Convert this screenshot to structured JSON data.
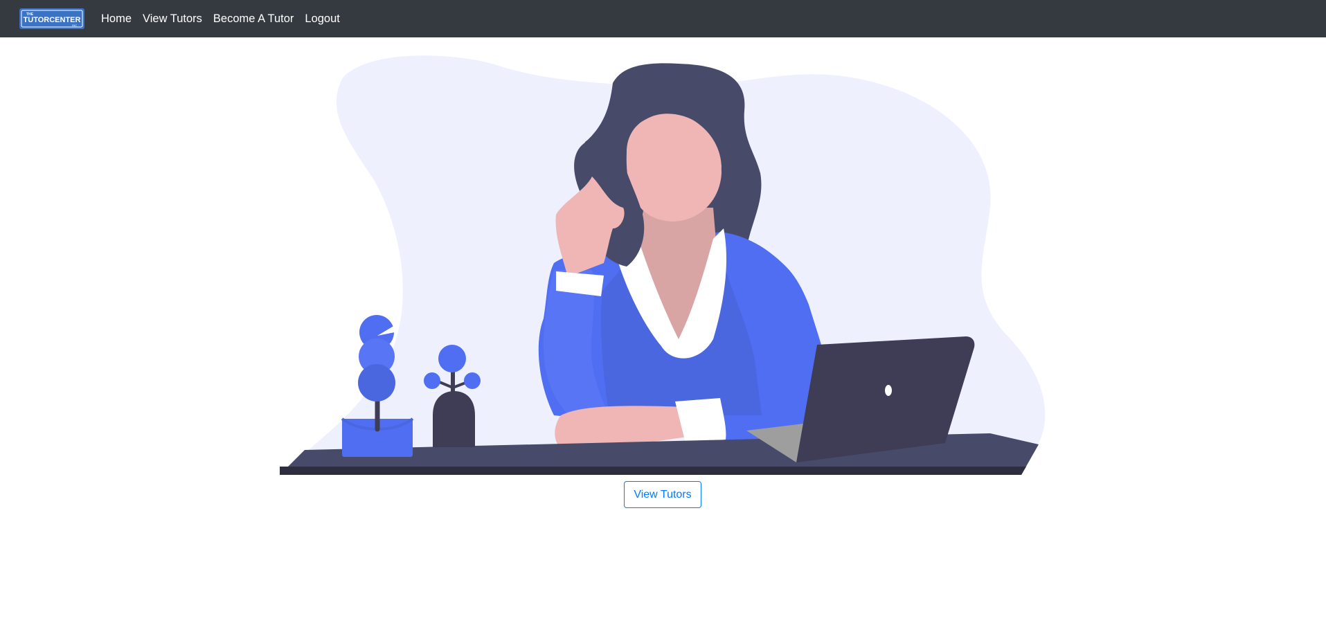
{
  "navbar": {
    "logo": {
      "top_text": "THE",
      "main_text": "TUTORCENTER",
      "sub_text": "INC",
      "colors": {
        "background": "#3a73c4",
        "text": "#ffffff"
      }
    },
    "links": [
      {
        "label": "Home"
      },
      {
        "label": "View Tutors"
      },
      {
        "label": "Become A Tutor"
      },
      {
        "label": "Logout"
      }
    ]
  },
  "hero": {
    "illustration": "woman-at-desk-with-laptop-illustration"
  },
  "cta": {
    "label": "View Tutors"
  },
  "colors": {
    "navbar": "#343a40",
    "accent": "#007bff",
    "illustration_blue": "#4f6ef2",
    "illustration_dark": "#3f3d56",
    "illustration_bg": "#eef1fd",
    "skin": "#f0b5b5"
  }
}
